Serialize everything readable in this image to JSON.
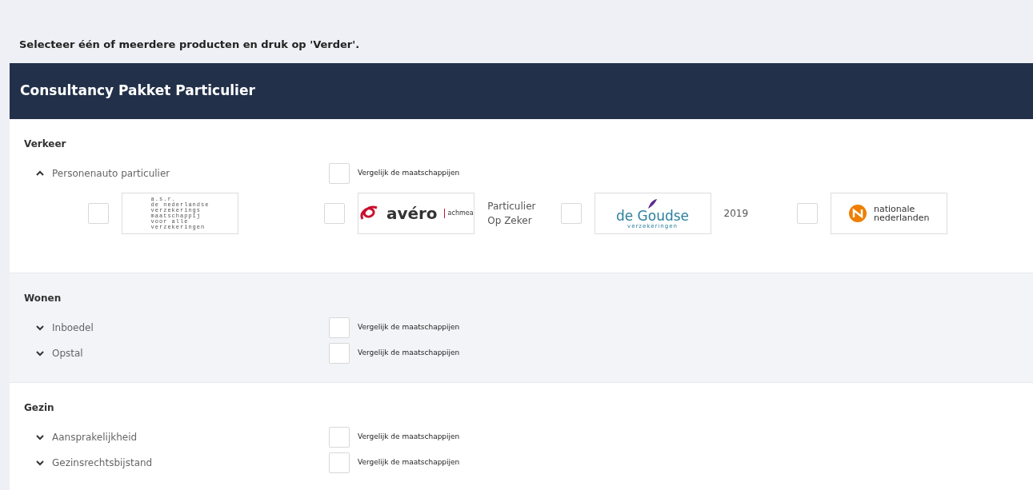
{
  "instruction": "Selecteer één of meerdere producten en druk op 'Verder'.",
  "package": {
    "title": "Consultancy Pakket Particulier"
  },
  "sections": [
    {
      "title": "Verkeer",
      "products": [
        {
          "name": "Personenauto particulier",
          "expanded": true,
          "compare_label": "Vergelijk de maatschappijen",
          "compare_checked": false,
          "insurers": [
            {
              "kind": "asr",
              "checked": false,
              "logo_text": [
                "a.s.r.",
                "de nederlandse",
                "verzekerings",
                "maatschappij",
                "voor alle",
                "verzekeringen"
              ]
            },
            {
              "kind": "avero",
              "checked": false,
              "logo_text": [
                "avéro",
                "achmea"
              ],
              "caption": "Particulier Op Zeker"
            },
            {
              "kind": "goudse",
              "checked": false,
              "logo_text": [
                "de Goudse",
                "verzekeringen"
              ],
              "caption": "2019"
            },
            {
              "kind": "nn",
              "checked": false,
              "logo_text": [
                "nationale",
                "nederlanden"
              ]
            }
          ]
        }
      ]
    },
    {
      "title": "Wonen",
      "products": [
        {
          "name": "Inboedel",
          "expanded": false,
          "compare_label": "Vergelijk de maatschappijen",
          "compare_checked": false
        },
        {
          "name": "Opstal",
          "expanded": false,
          "compare_label": "Vergelijk de maatschappijen",
          "compare_checked": false
        }
      ]
    },
    {
      "title": "Gezin",
      "products": [
        {
          "name": "Aansprakelijkheid",
          "expanded": false,
          "compare_label": "Vergelijk de maatschappijen",
          "compare_checked": false
        },
        {
          "name": "Gezinsrechtsbijstand",
          "expanded": false,
          "compare_label": "Vergelijk de maatschappijen",
          "compare_checked": false
        }
      ]
    }
  ]
}
